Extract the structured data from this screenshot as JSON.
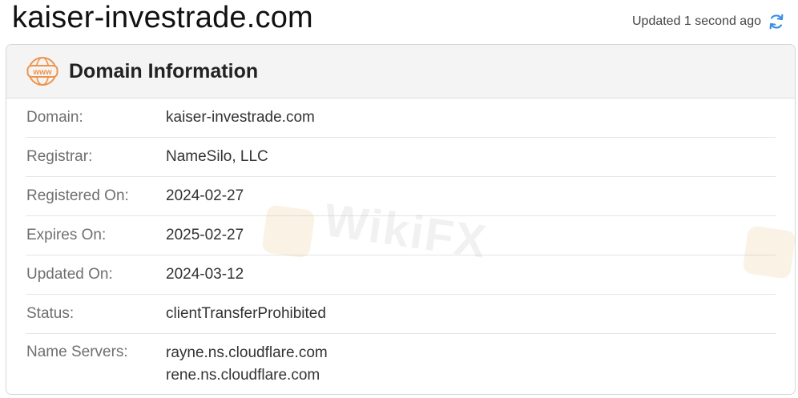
{
  "site_title": "kaiser-investrade.com",
  "updated_text": "Updated 1 second ago",
  "card": {
    "title": "Domain Information",
    "icon_text": "www"
  },
  "rows": [
    {
      "label": "Domain:",
      "value": "kaiser-investrade.com"
    },
    {
      "label": "Registrar:",
      "value": "NameSilo, LLC"
    },
    {
      "label": "Registered On:",
      "value": "2024-02-27"
    },
    {
      "label": "Expires On:",
      "value": "2025-02-27"
    },
    {
      "label": "Updated On:",
      "value": "2024-03-12"
    },
    {
      "label": "Status:",
      "value": "clientTransferProhibited"
    },
    {
      "label": "Name Servers:",
      "values": [
        "rayne.ns.cloudflare.com",
        "rene.ns.cloudflare.com"
      ]
    }
  ],
  "watermark": "WikiFX",
  "colors": {
    "accent_orange": "#f0934a",
    "refresh_blue": "#3a8ee6"
  }
}
